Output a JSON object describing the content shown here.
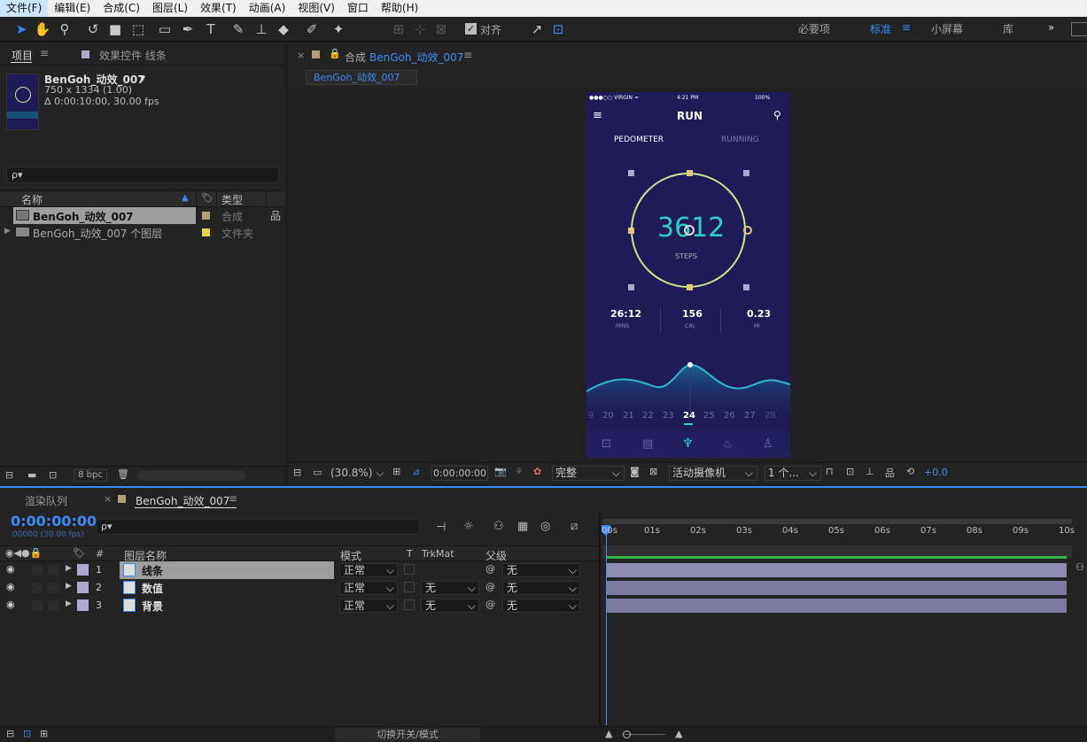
{
  "menu": [
    "文件(F)",
    "编辑(E)",
    "合成(C)",
    "图层(L)",
    "效果(T)",
    "动画(A)",
    "视图(V)",
    "窗口",
    "帮助(H)"
  ],
  "toolbar": {
    "align_label": "对齐",
    "workspaces": [
      "必要项",
      "标准",
      "小屏幕",
      "库"
    ],
    "active_workspace": "标准",
    "more": "»"
  },
  "project": {
    "tab_label": "项目",
    "effects_tab_label": "效果控件 线条",
    "comp_name": "BenGoh_动效_007",
    "comp_size": "750 x 1334 (1.00)",
    "comp_duration": "Δ 0:00:10:00, 30.00 fps",
    "search_placeholder": "ρ▾",
    "col_name": "名称",
    "col_type": "类型",
    "items": [
      {
        "name": "BenGoh_动效_007",
        "type": "合成",
        "color": "#b39f7a"
      },
      {
        "name": "BenGoh_动效_007 个图层",
        "type": "文件夹",
        "color": "#e5d348"
      }
    ],
    "bpc": "8 bpc"
  },
  "viewer": {
    "tab_prefix": "合成",
    "tab_name": "BenGoh_动效_007",
    "sub_tab": "BenGoh_动效_007",
    "zoom": "(30.8%)",
    "timecode": "0:00:00:00",
    "quality": "完整",
    "camera": "活动摄像机",
    "views": "1 个...",
    "exposure": "+0.0"
  },
  "phone": {
    "carrier": "●●●○○ VIRGIN ≈",
    "time": "4:21 PM",
    "battery": "100%",
    "title": "RUN",
    "tab_pedometer": "PEDOMETER",
    "tab_running": "RUNNING",
    "steps": "3612",
    "steps_label": "STEPS",
    "stats": [
      {
        "value": "26:12",
        "label": "MINS"
      },
      {
        "value": "156",
        "label": "CAL"
      },
      {
        "value": "0.23",
        "label": "MI"
      }
    ],
    "dates": [
      "9",
      "20",
      "21",
      "22",
      "23",
      "24",
      "25",
      "26",
      "27",
      "28"
    ],
    "active_date": "24",
    "accent": "#29d3c3",
    "ring_color": "#c9e88a"
  },
  "timeline": {
    "render_tab": "渲染队列",
    "comp_tab": "BenGoh_动效_007",
    "timecode": "0:00:00:00",
    "frame_info": "00000 (30.00 fps)",
    "search_placeholder": "ρ▾",
    "col_hash": "#",
    "col_name": "图层名称",
    "col_mode": "模式",
    "col_t": "T",
    "col_trkmat": "TrkMat",
    "col_parent": "父级",
    "layers": [
      {
        "num": "1",
        "name": "线条",
        "mode": "正常",
        "trkmat": "",
        "parent": "无"
      },
      {
        "num": "2",
        "name": "数值",
        "mode": "正常",
        "trkmat": "无",
        "parent": "无"
      },
      {
        "num": "3",
        "name": "背景",
        "mode": "正常",
        "trkmat": "无",
        "parent": "无"
      }
    ],
    "ruler": [
      "00s",
      "01s",
      "02s",
      "03s",
      "04s",
      "05s",
      "06s",
      "07s",
      "08s",
      "09s",
      "10s"
    ],
    "footer_label": "切换开关/模式"
  }
}
